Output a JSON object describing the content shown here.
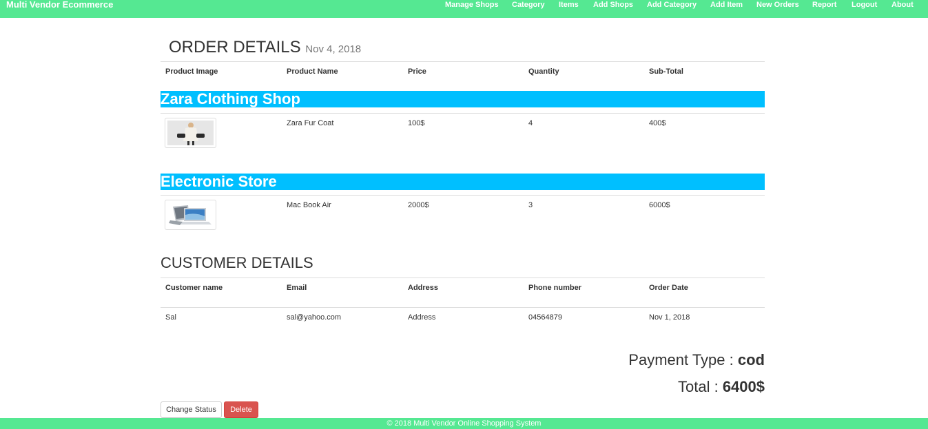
{
  "nav": {
    "brand": "Multi Vendor Ecommerce",
    "links": [
      "Manage Shops",
      "Category",
      "Items",
      "Add Shops",
      "Add Category",
      "Add Item",
      "New Orders",
      "Report",
      "Logout",
      "About"
    ]
  },
  "order": {
    "title": "ORDER DETAILS",
    "date": "Nov 4, 2018",
    "headers": [
      "Product Image",
      "Product Name",
      "Price",
      "Quantity",
      "Sub-Total"
    ],
    "shops": [
      {
        "name": "Zara Clothing Shop",
        "items": [
          {
            "image": "fur-coat-image",
            "name": "Zara Fur Coat",
            "price": "100$",
            "quantity": "4",
            "subtotal": "400$"
          }
        ]
      },
      {
        "name": "Electronic Store",
        "items": [
          {
            "image": "laptop-image",
            "name": "Mac Book Air",
            "price": "2000$",
            "quantity": "3",
            "subtotal": "6000$"
          }
        ]
      }
    ]
  },
  "customer": {
    "title": "CUSTOMER DETAILS",
    "headers": [
      "Customer name",
      "Email",
      "Address",
      "Phone number",
      "Order Date"
    ],
    "row": [
      "Sal",
      "sal@yahoo.com",
      "Address",
      "04564879",
      "Nov 1, 2018"
    ]
  },
  "summary": {
    "payment_label": "Payment Type : ",
    "payment_value": "cod",
    "total_label": "Total : ",
    "total_value": "6400$"
  },
  "actions": {
    "change_status": "Change Status",
    "delete": "Delete"
  },
  "footer": {
    "text": "© 2018 Multi Vendor Online Shopping System"
  },
  "colors": {
    "nav_bg": "#55e892",
    "shop_bar": "#00bfff",
    "danger": "#d9534f"
  }
}
